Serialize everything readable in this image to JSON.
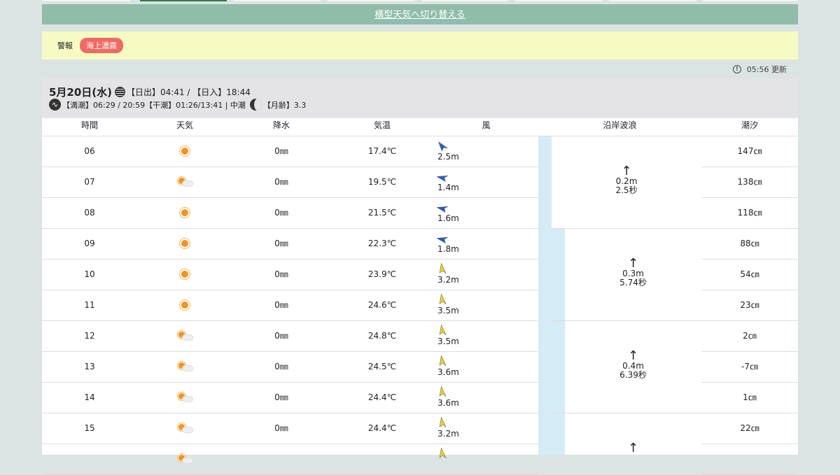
{
  "switch_link": "横型天気へ切り替える",
  "warning": {
    "label": "警報",
    "badge": "海上濃霧"
  },
  "updated": "05:56 更新",
  "day": {
    "date": "5月20日(水)",
    "sun_text": "【日出】04:41 / 【日入】18:44",
    "tide_text": "【満潮】06:29 / 20:59【干潮】01:26/13:41 | 中潮",
    "moon_text": "【月齢】3.3"
  },
  "headers": [
    "時間",
    "天気",
    "降水",
    "気温",
    "風",
    "沿岸波浪",
    "潮汐"
  ],
  "rows": [
    {
      "hour": "06",
      "weather": "sunny-icon",
      "precip": "0㎜",
      "temp": "17.4℃",
      "wind_dir": "NW",
      "wind_color": "#1f5fc7",
      "wind_angle": -20,
      "wind_speed": "2.5m",
      "tide": "147㎝"
    },
    {
      "hour": "07",
      "weather": "partly-cloudy-icon",
      "precip": "0㎜",
      "temp": "19.5℃",
      "wind_dir": "NW",
      "wind_color": "#1f5fc7",
      "wind_angle": -60,
      "wind_speed": "1.4m",
      "tide": "138㎝"
    },
    {
      "hour": "08",
      "weather": "sunny-icon",
      "precip": "0㎜",
      "temp": "21.5℃",
      "wind_dir": "NW",
      "wind_color": "#1f5fc7",
      "wind_angle": -60,
      "wind_speed": "1.6m",
      "tide": "118㎝"
    },
    {
      "hour": "09",
      "weather": "sunny-icon",
      "precip": "0㎜",
      "temp": "22.3℃",
      "wind_dir": "NW",
      "wind_color": "#1f5fc7",
      "wind_angle": -60,
      "wind_speed": "1.8m",
      "tide": "88㎝"
    },
    {
      "hour": "10",
      "weather": "sunny-icon",
      "precip": "0㎜",
      "temp": "23.9℃",
      "wind_dir": "N",
      "wind_color": "#f2d024",
      "wind_angle": 10,
      "wind_speed": "3.2m",
      "tide": "54㎝"
    },
    {
      "hour": "11",
      "weather": "sunny-icon",
      "precip": "0㎜",
      "temp": "24.6℃",
      "wind_dir": "N",
      "wind_color": "#f2d024",
      "wind_angle": 10,
      "wind_speed": "3.5m",
      "tide": "23㎝"
    },
    {
      "hour": "12",
      "weather": "partly-cloudy-icon",
      "precip": "0㎜",
      "temp": "24.8℃",
      "wind_dir": "N",
      "wind_color": "#f2d024",
      "wind_angle": 10,
      "wind_speed": "3.5m",
      "tide": "2㎝"
    },
    {
      "hour": "13",
      "weather": "partly-cloudy-icon",
      "precip": "0㎜",
      "temp": "24.5℃",
      "wind_dir": "N",
      "wind_color": "#f2d024",
      "wind_angle": 10,
      "wind_speed": "3.6m",
      "tide": "-7㎝"
    },
    {
      "hour": "14",
      "weather": "partly-cloudy-icon",
      "precip": "0㎜",
      "temp": "24.4℃",
      "wind_dir": "N",
      "wind_color": "#f2d024",
      "wind_angle": 10,
      "wind_speed": "3.6m",
      "tide": "1㎝"
    },
    {
      "hour": "15",
      "weather": "partly-cloudy-icon",
      "precip": "0㎜",
      "temp": "24.4℃",
      "wind_dir": "N",
      "wind_color": "#f2d024",
      "wind_angle": 10,
      "wind_speed": "3.2m",
      "tide": "22㎝"
    },
    {
      "hour": "",
      "weather": "partly-cloudy-icon",
      "precip": "",
      "temp": "",
      "wind_dir": "N",
      "wind_color": "#f2d024",
      "wind_angle": 10,
      "wind_speed": "",
      "tide": ""
    }
  ],
  "waves": [
    {
      "height": "0.2m",
      "period": "2.5秒"
    },
    {
      "height": "0.3m",
      "period": "5.74秒"
    },
    {
      "height": "0.4m",
      "period": "6.39秒"
    },
    {
      "height": "",
      "period": ""
    }
  ]
}
